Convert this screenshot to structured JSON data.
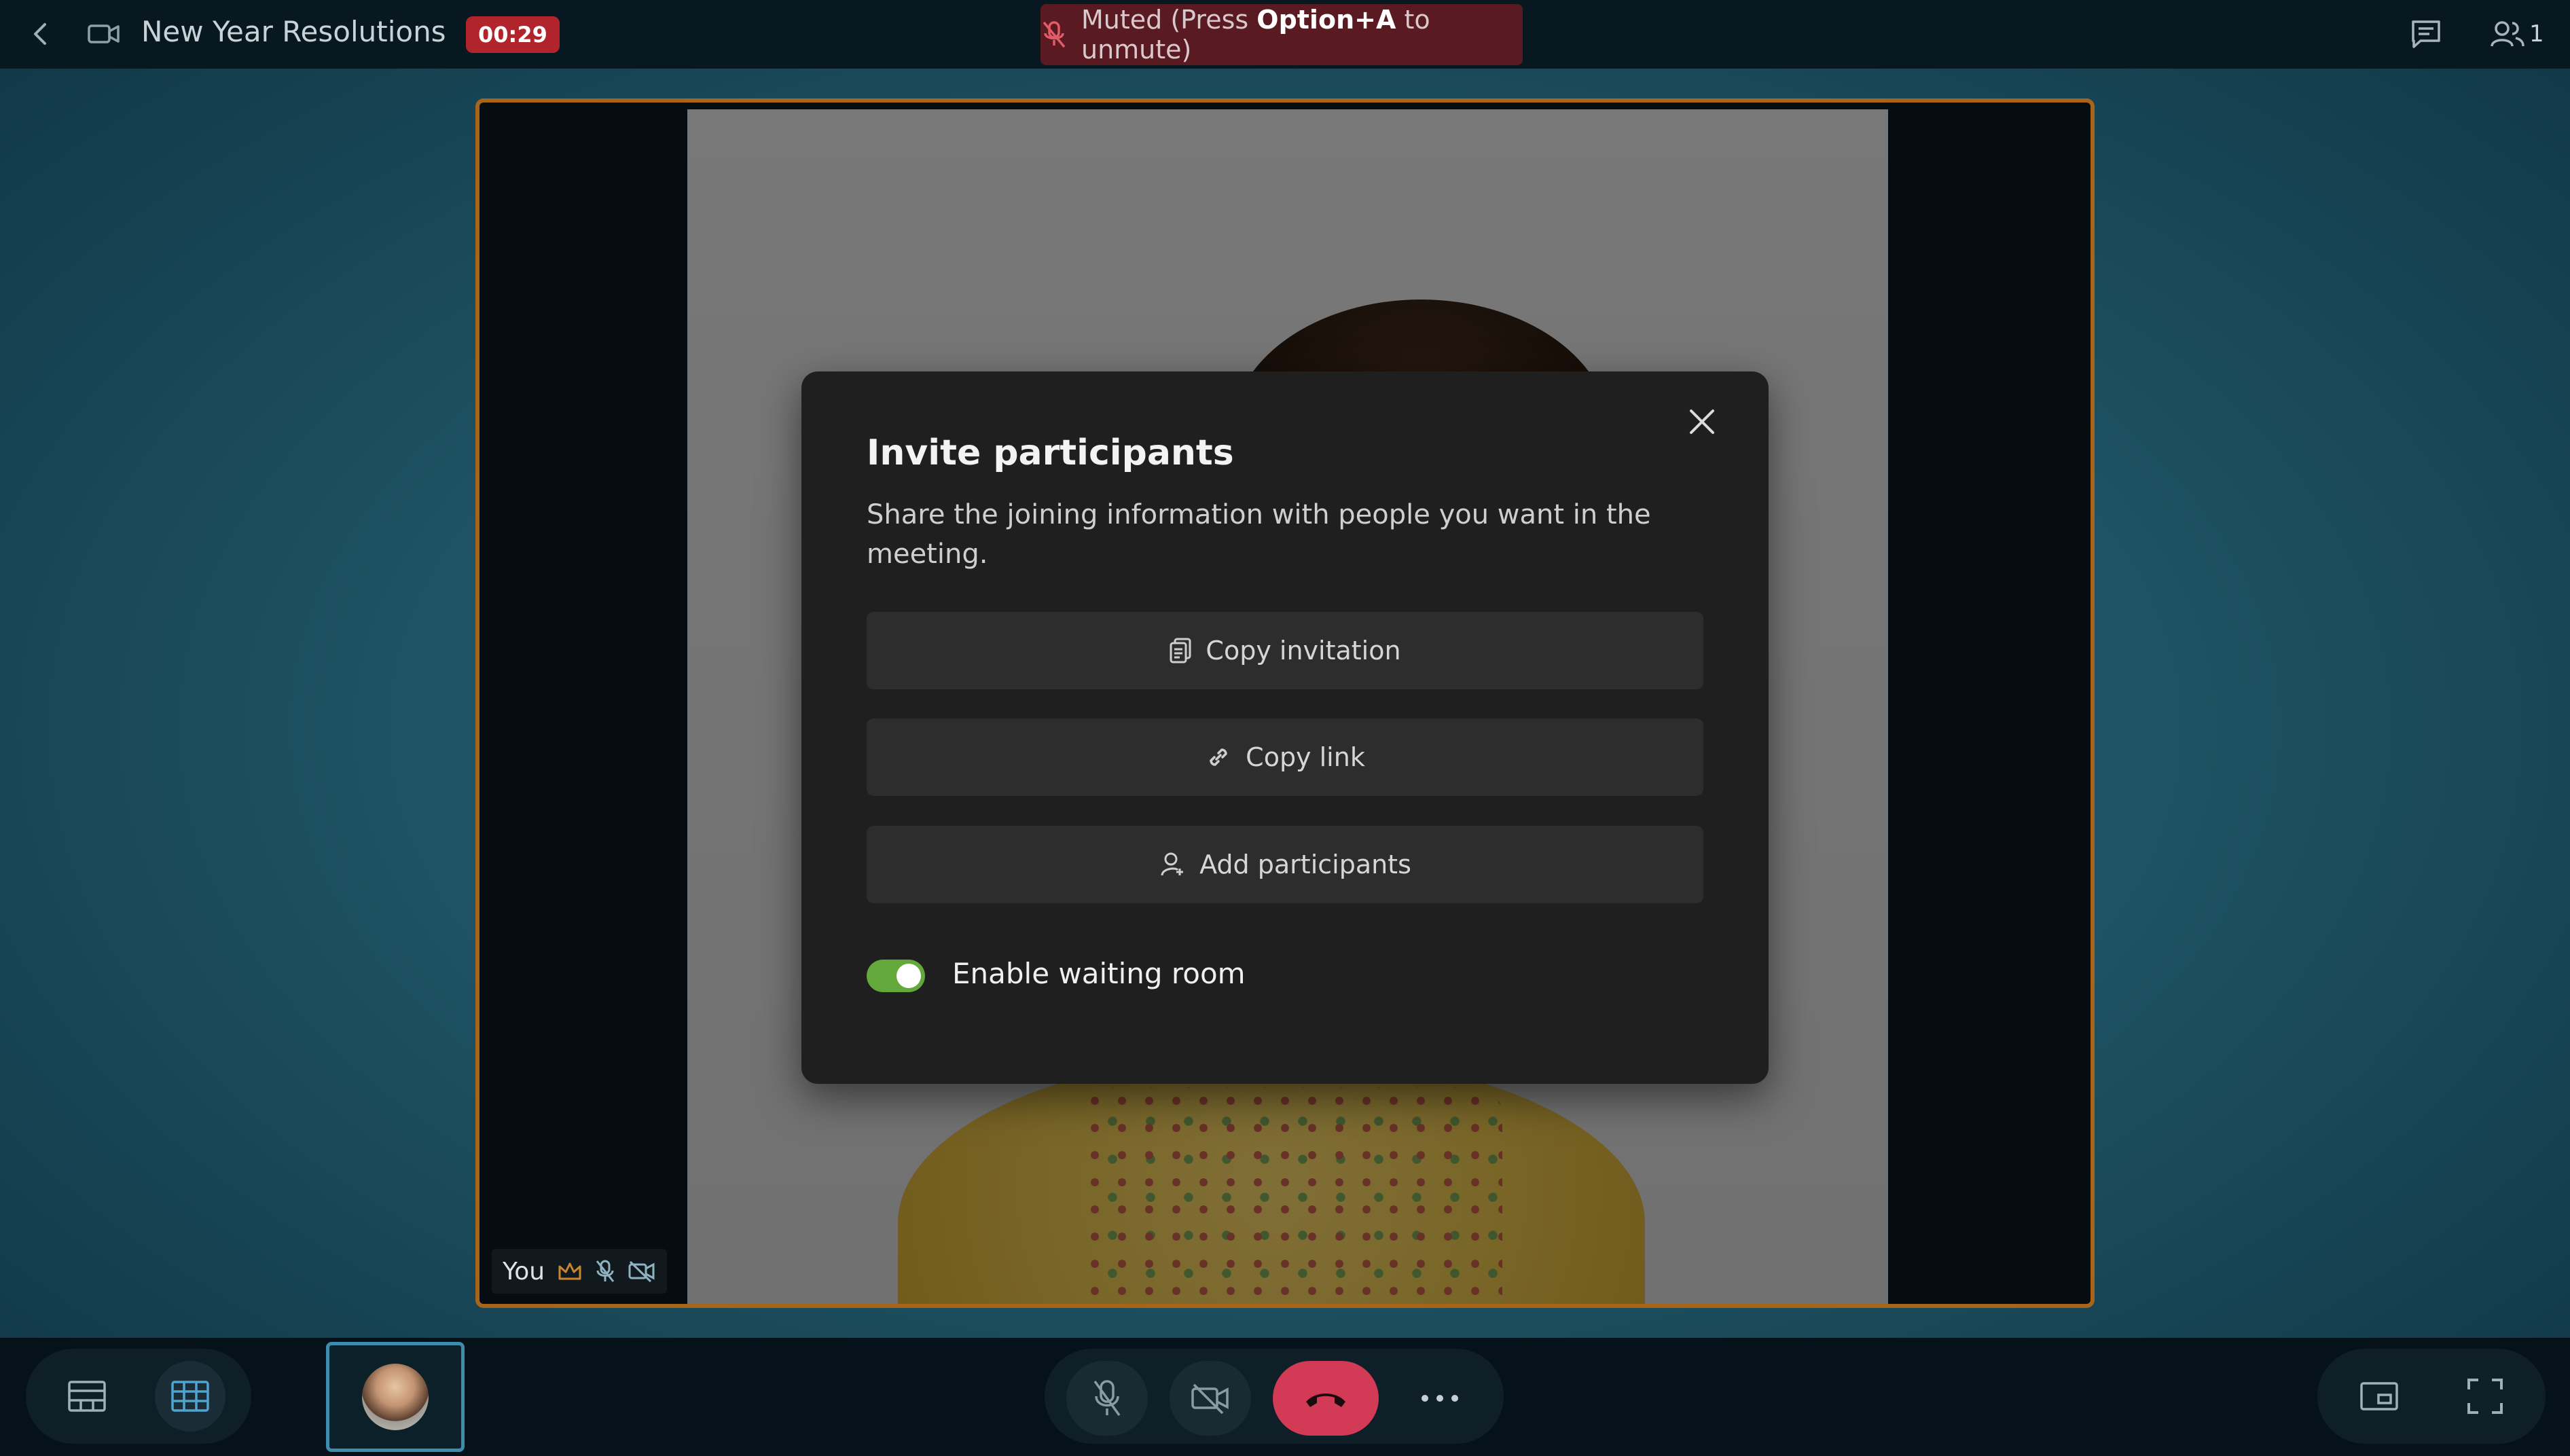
{
  "header": {
    "title": "New Year Resolutions",
    "timer": "00:29",
    "muted_prefix": "Muted (Press ",
    "muted_key": "Option+A",
    "muted_suffix": " to unmute)",
    "participant_count": "1"
  },
  "tile": {
    "name": "You"
  },
  "dialog": {
    "title": "Invite participants",
    "subtitle": "Share the joining information with people you want in the meeting.",
    "buttons": {
      "copy_invitation": "Copy invitation",
      "copy_link": "Copy link",
      "add_participants": "Add participants"
    },
    "waiting_room_label": "Enable waiting room",
    "waiting_room_enabled": true
  },
  "colors": {
    "accent_border": "#a7651c",
    "timer_bg": "#b1242b",
    "end_call": "#d23a55",
    "toggle_on": "#62a83a"
  },
  "icons": [
    "back-icon",
    "video-camera-icon",
    "mic-off-icon",
    "chat-icon",
    "people-icon",
    "close-icon",
    "copy-icon",
    "link-icon",
    "add-person-icon",
    "crown-icon",
    "camera-off-icon",
    "layout-speaker-icon",
    "layout-grid-icon",
    "hang-up-icon",
    "more-icon",
    "pip-icon",
    "fullscreen-icon"
  ]
}
